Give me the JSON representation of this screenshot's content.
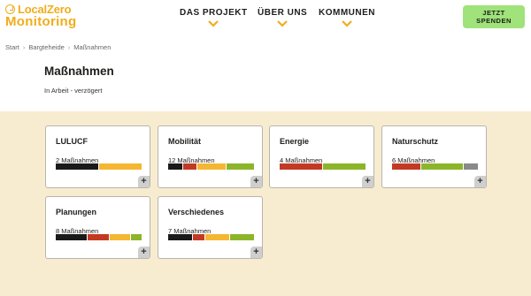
{
  "header": {
    "logo_line1": "LocalZero",
    "logo_line2": "Monitoring",
    "nav": [
      {
        "label": "DAS PROJEKT"
      },
      {
        "label": "ÜBER UNS"
      },
      {
        "label": "KOMMUNEN"
      }
    ],
    "cta_line1": "JETZT",
    "cta_line2": "SPENDEN"
  },
  "breadcrumb": [
    "Start",
    "Bargteheide",
    "Maßnahmen"
  ],
  "breadcrumb_sep": "›",
  "page_title": "Maßnahmen",
  "status_text": "In Arbeit - verzögert",
  "colors": {
    "black": "#1a1a1a",
    "red": "#c33a24",
    "yellow": "#f5b731",
    "green": "#8db52a",
    "gray": "#8a8a8a",
    "accent": "#f0ad1b",
    "cta": "#9fe37a",
    "content_bg": "#f8ecd0"
  },
  "cards": [
    {
      "title": "LULUCF",
      "count": "2 Maßnahmen",
      "segments": [
        {
          "color": "black",
          "value": 1
        },
        {
          "color": "yellow",
          "value": 1
        }
      ],
      "plus": "+"
    },
    {
      "title": "Mobilität",
      "count": "12 Maßnahmen",
      "segments": [
        {
          "color": "black",
          "value": 2
        },
        {
          "color": "red",
          "value": 2
        },
        {
          "color": "yellow",
          "value": 4
        },
        {
          "color": "green",
          "value": 4
        }
      ],
      "plus": "+"
    },
    {
      "title": "Energie",
      "count": "4 Maßnahmen",
      "segments": [
        {
          "color": "red",
          "value": 2
        },
        {
          "color": "green",
          "value": 2
        }
      ],
      "plus": "+"
    },
    {
      "title": "Naturschutz",
      "count": "6 Maßnahmen",
      "segments": [
        {
          "color": "red",
          "value": 2
        },
        {
          "color": "green",
          "value": 3
        },
        {
          "color": "gray",
          "value": 1
        }
      ],
      "plus": "+"
    },
    {
      "title": "Planungen",
      "count": "8 Maßnahmen",
      "segments": [
        {
          "color": "black",
          "value": 3
        },
        {
          "color": "red",
          "value": 2
        },
        {
          "color": "yellow",
          "value": 2
        },
        {
          "color": "green",
          "value": 1
        }
      ],
      "plus": "+"
    },
    {
      "title": "Verschiedenes",
      "count": "7 Maßnahmen",
      "segments": [
        {
          "color": "black",
          "value": 2
        },
        {
          "color": "red",
          "value": 1
        },
        {
          "color": "yellow",
          "value": 2
        },
        {
          "color": "green",
          "value": 2
        }
      ],
      "plus": "+"
    }
  ]
}
